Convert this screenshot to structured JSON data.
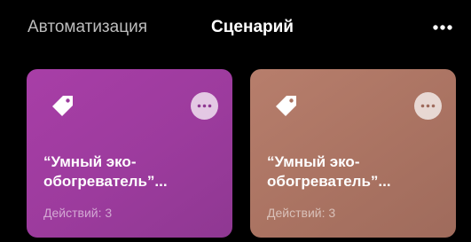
{
  "header": {
    "tabs": [
      {
        "label": "Автоматизация",
        "active": false
      },
      {
        "label": "Сценарий",
        "active": true
      }
    ],
    "more_icon": "more-horizontal-icon"
  },
  "cards": [
    {
      "title": "“Умный эко-обогреватель”...",
      "subtitle": "Действий: 3",
      "icon": "tag-icon",
      "menu_icon": "more-circle-icon",
      "color": "#9c3b9d"
    },
    {
      "title": "“Умный эко-обогреватель”...",
      "subtitle": "Действий: 3",
      "icon": "tag-icon",
      "menu_icon": "more-circle-icon",
      "color": "#aa7362"
    }
  ],
  "colors": {
    "background": "#000000",
    "active_tab": "#ffffff",
    "inactive_tab": "#bdbdbd"
  }
}
